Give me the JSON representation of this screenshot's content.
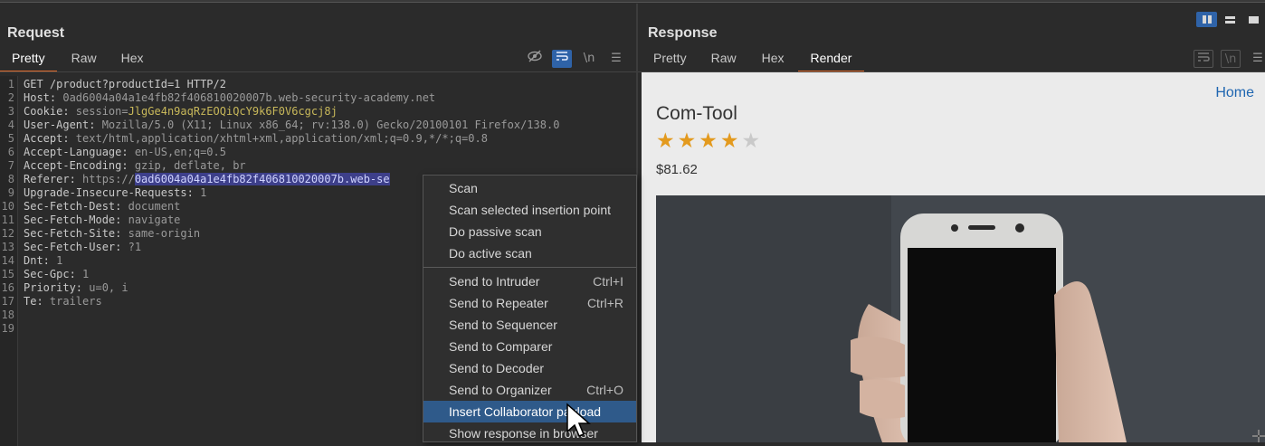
{
  "request": {
    "title": "Request",
    "tabs": [
      "Pretty",
      "Raw",
      "Hex"
    ],
    "toolbar_icons": [
      "eye-off-icon",
      "wrap-icon",
      "newline-icon",
      "menu-icon"
    ],
    "newline_label": "\\n",
    "lines": [
      "GET /product?productId=1 HTTP/2",
      "Host: 0ad6004a04a1e4fb82f406810020007b.web-security-academy.net",
      "Cookie: session=JlgGe4n9aqRzEOQiQcY9k6F0V6cgcj8j",
      "User-Agent: Mozilla/5.0 (X11; Linux x86_64; rv:138.0) Gecko/20100101 Firefox/138.0",
      "Accept: text/html,application/xhtml+xml,application/xml;q=0.9,*/*;q=0.8",
      "Accept-Language: en-US,en;q=0.5",
      "Accept-Encoding: gzip, deflate, br",
      "Referer: https://0ad6004a04a1e4fb82f406810020007b.web-se",
      "Upgrade-Insecure-Requests: 1",
      "Sec-Fetch-Dest: document",
      "Sec-Fetch-Mode: navigate",
      "Sec-Fetch-Site: same-origin",
      "Sec-Fetch-User: ?1",
      "Dnt: 1",
      "Sec-Gpc: 1",
      "Priority: u=0, i",
      "Te: trailers",
      "",
      ""
    ],
    "line_numbers": [
      "1",
      "2",
      "3",
      "4",
      "5",
      "6",
      "7",
      "8",
      "9",
      "10",
      "11",
      "12",
      "13",
      "14",
      "15",
      "16",
      "17",
      "18",
      "19"
    ]
  },
  "response": {
    "title": "Response",
    "tabs": [
      "Pretty",
      "Raw",
      "Hex",
      "Render"
    ],
    "newline_label": "\\n",
    "render": {
      "home_link": "Home",
      "product_title": "Com-Tool",
      "rating": 4,
      "max_rating": 5,
      "price": "$81.62",
      "star_color": "#e39a1e",
      "star_empty_color": "#c9c9c9"
    }
  },
  "layout_buttons": [
    "split-horizontal-icon",
    "split-vertical-icon",
    "single-pane-icon"
  ],
  "context_menu": {
    "groups": [
      [
        {
          "label": "Scan",
          "shortcut": ""
        },
        {
          "label": "Scan selected insertion point",
          "shortcut": ""
        },
        {
          "label": "Do passive scan",
          "shortcut": ""
        },
        {
          "label": "Do active scan",
          "shortcut": ""
        }
      ],
      [
        {
          "label": "Send to Intruder",
          "shortcut": "Ctrl+I"
        },
        {
          "label": "Send to Repeater",
          "shortcut": "Ctrl+R"
        },
        {
          "label": "Send to Sequencer",
          "shortcut": ""
        },
        {
          "label": "Send to Comparer",
          "shortcut": ""
        },
        {
          "label": "Send to Decoder",
          "shortcut": ""
        },
        {
          "label": "Send to Organizer",
          "shortcut": "Ctrl+O"
        },
        {
          "label": "Insert Collaborator payload",
          "shortcut": ""
        },
        {
          "label": "Show response in browser",
          "shortcut": ""
        }
      ]
    ],
    "highlighted": "Insert Collaborator payload"
  },
  "colors": {
    "accent": "#e06b2c",
    "selection": "#2f63a8"
  }
}
